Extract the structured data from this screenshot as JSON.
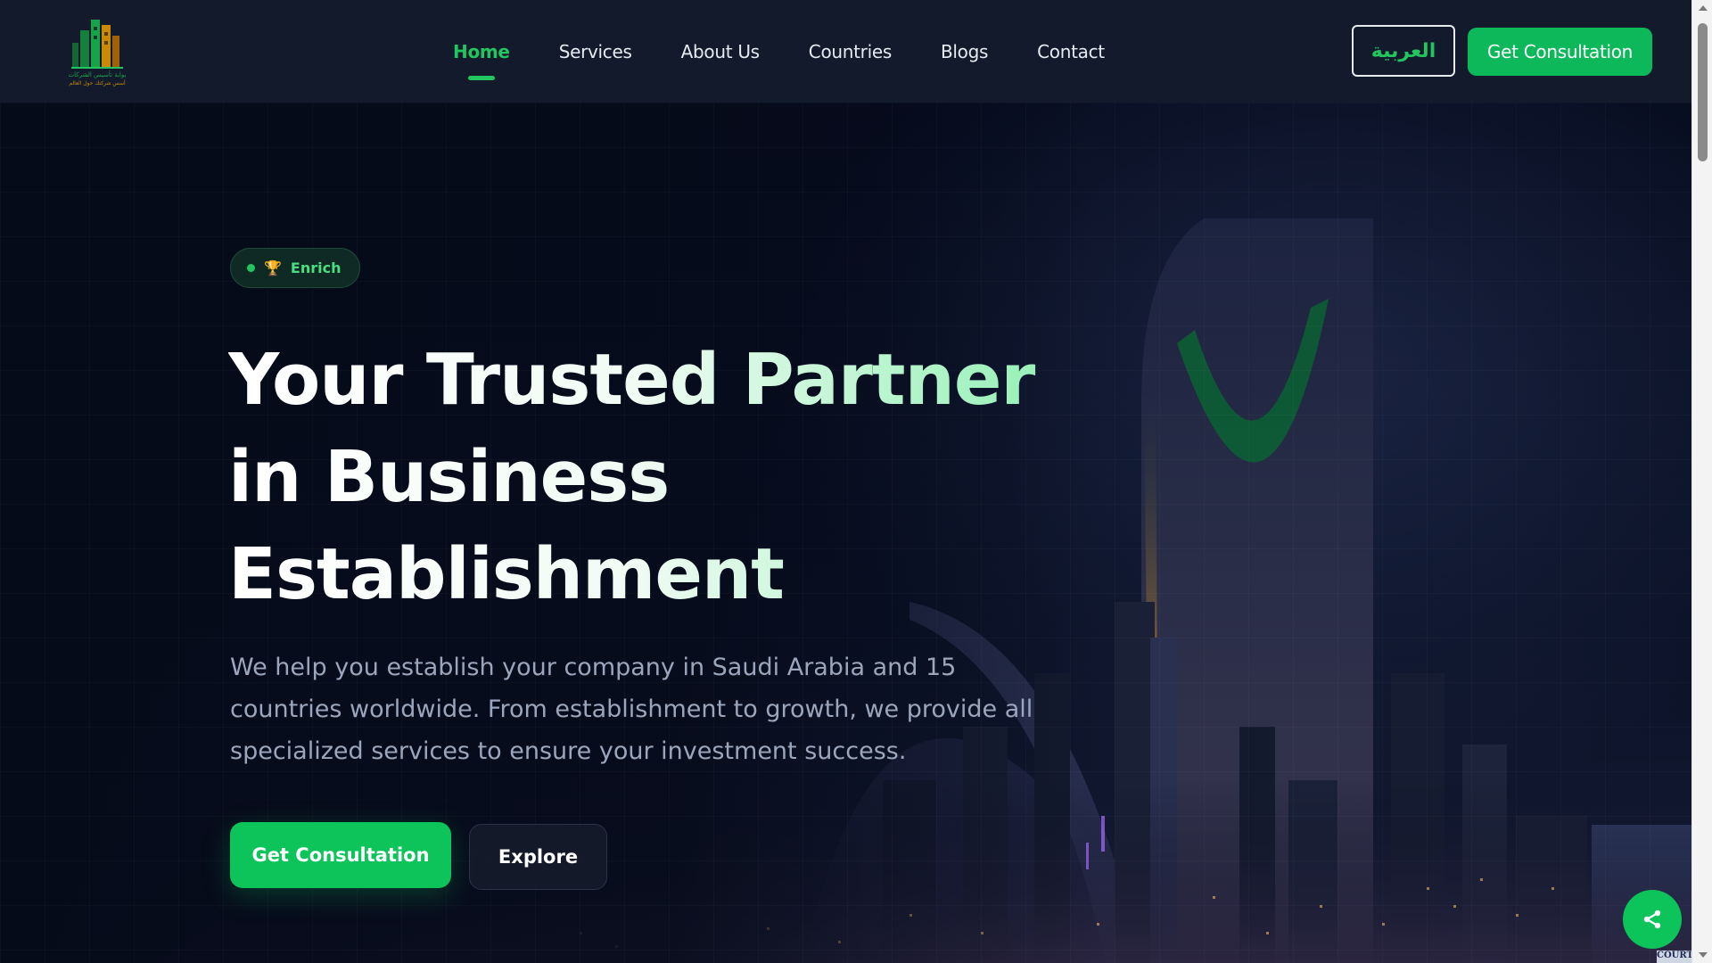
{
  "nav": {
    "logo_text_line1": "بوابة تأسيس الشركات",
    "logo_text_line2": "أسس شركتك حول العالم",
    "links": [
      {
        "label": "Home",
        "active": true
      },
      {
        "label": "Services",
        "active": false
      },
      {
        "label": "About Us",
        "active": false
      },
      {
        "label": "Countries",
        "active": false
      },
      {
        "label": "Blogs",
        "active": false
      },
      {
        "label": "Contact",
        "active": false
      }
    ],
    "language_label": "العربية",
    "cta_label": "Get Consultation"
  },
  "hero": {
    "badge": {
      "icon": "trophy-icon",
      "label": "Enrich"
    },
    "title_lines": [
      "Your Trusted Partner",
      "in Business",
      "Establishment"
    ],
    "description": "We help you establish your company in Saudi Arabia and 15 countries worldwide. From establishment to growth, we provide all specialized services to ensure your investment success.",
    "primary_button": "Get Consultation",
    "secondary_button": "Explore"
  },
  "share": {
    "icon": "share-icon"
  },
  "corner_tag": "COURT",
  "colors": {
    "accent": "#22c55e",
    "button_green": "#0cc45a",
    "nav_bg": "#121a2b",
    "hero_bg": "#060b1a"
  }
}
